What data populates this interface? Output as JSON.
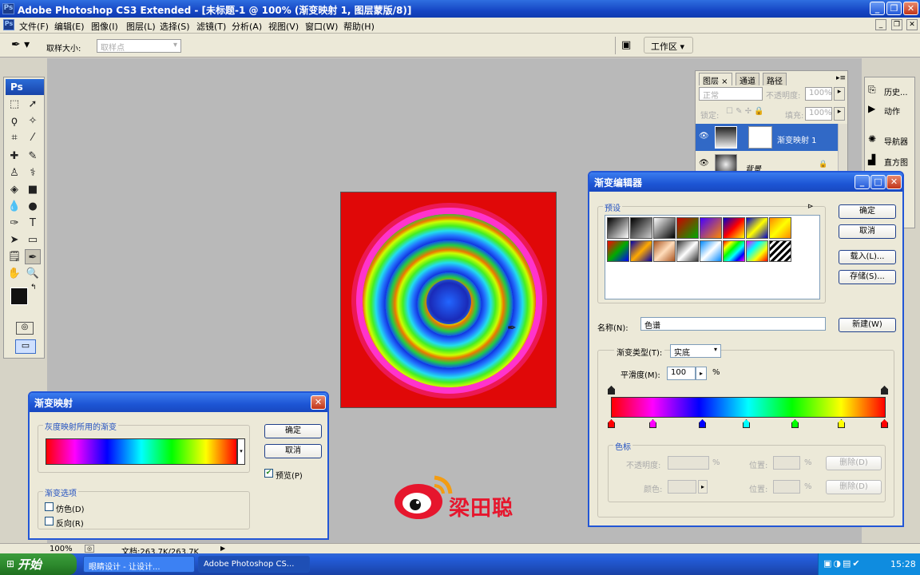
{
  "app": {
    "title": "Adobe Photoshop CS3 Extended - [未标题-1 @ 100% (渐变映射 1, 图层蒙版/8)]",
    "icon": "Ps"
  },
  "menu": [
    "文件(F)",
    "编辑(E)",
    "图像(I)",
    "图层(L)",
    "选择(S)",
    "滤镜(T)",
    "分析(A)",
    "视图(V)",
    "窗口(W)",
    "帮助(H)"
  ],
  "options": {
    "sample_size_label": "取样大小:",
    "sample_size_value": "取样点",
    "workspace_label": "工作区 ▾"
  },
  "toolbox": {
    "header": "Ps"
  },
  "layers_panel": {
    "tabs": [
      "图层 ×",
      "通道",
      "路径"
    ],
    "blend_mode": "正常",
    "opacity_label": "不透明度:",
    "opacity_value": "100%",
    "lock_label": "锁定:",
    "fill_label": "填充:",
    "fill_value": "100%",
    "layers": [
      {
        "name": "渐变映射 1"
      },
      {
        "name": "背景"
      }
    ]
  },
  "right_panel": {
    "items": [
      "历史...",
      "动作",
      "导航器",
      "直方图"
    ]
  },
  "gradient_map_dialog": {
    "title": "渐变映射",
    "group_title": "灰度映射所用的渐变",
    "options_title": "渐变选项",
    "dither_label": "仿色(D)",
    "reverse_label": "反向(R)",
    "ok_label": "确定",
    "cancel_label": "取消",
    "preview_label": "预览(P)",
    "preview_checked": true,
    "dither_checked": false,
    "reverse_checked": false
  },
  "gradient_editor": {
    "title": "渐变编辑器",
    "presets_label": "预设",
    "ok_label": "确定",
    "cancel_label": "取消",
    "load_label": "载入(L)...",
    "save_label": "存储(S)...",
    "name_label": "名称(N):",
    "name_value": "色谱",
    "new_label": "新建(W)",
    "type_label": "渐变类型(T):",
    "type_value": "实底",
    "smoothness_label": "平滑度(M):",
    "smoothness_value": "100",
    "smoothness_unit": "%",
    "stops_group": "色标",
    "opacity_label": "不透明度:",
    "location_label": "位置:",
    "delete_label": "删除(D)",
    "color_label": "颜色:",
    "percent": "%",
    "color_stops": [
      "#ff0000",
      "#ff00ff",
      "#0000ff",
      "#00ffff",
      "#00ff00",
      "#ffff00",
      "#ff0000"
    ]
  },
  "status": {
    "zoom": "100%",
    "doc": "文档:263.7K/263.7K"
  },
  "taskbar": {
    "start": "开始",
    "tasks": [
      "眼睛设计 - 让设计...",
      "Adobe Photoshop CS..."
    ],
    "clock": "15:28"
  },
  "watermark": {
    "text": "梁田聪"
  }
}
